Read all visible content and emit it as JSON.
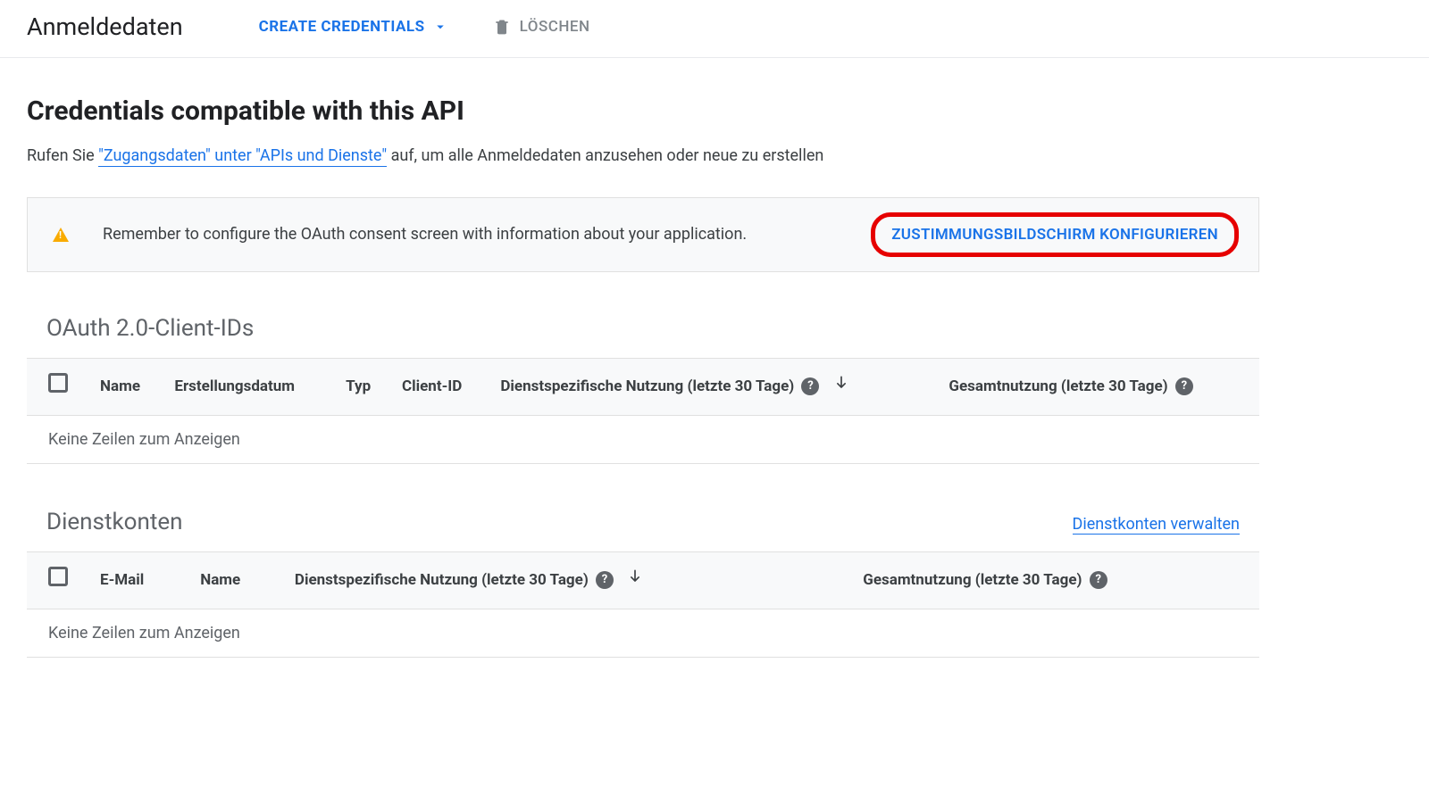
{
  "header": {
    "title": "Anmeldedaten",
    "create_label": "CREATE CREDENTIALS",
    "delete_label": "LÖSCHEN"
  },
  "main": {
    "heading": "Credentials compatible with this API",
    "desc_pre": "Rufen Sie ",
    "desc_link": "\"Zugangsdaten\" unter \"APIs und Dienste\"",
    "desc_post": " auf, um alle Anmeldedaten anzusehen oder neue zu erstellen"
  },
  "banner": {
    "text": "Remember to configure the OAuth consent screen with information about your application.",
    "action": "ZUSTIMMUNGSBILDSCHIRM KONFIGURIEREN"
  },
  "oauth_table": {
    "title": "OAuth 2.0-Client-IDs",
    "cols": {
      "name": "Name",
      "created": "Erstellungsdatum",
      "type": "Typ",
      "client_id": "Client-ID",
      "service_usage": "Dienstspezifische Nutzung (letzte 30 Tage)",
      "total_usage": "Gesamtnutzung (letzte 30 Tage)"
    },
    "empty": "Keine Zeilen zum Anzeigen"
  },
  "service_table": {
    "title": "Dienstkonten",
    "manage_link": "Dienstkonten verwalten",
    "cols": {
      "email": "E-Mail",
      "name": "Name",
      "service_usage": "Dienstspezifische Nutzung (letzte 30 Tage)",
      "total_usage": "Gesamtnutzung (letzte 30 Tage)"
    },
    "empty": "Keine Zeilen zum Anzeigen"
  }
}
